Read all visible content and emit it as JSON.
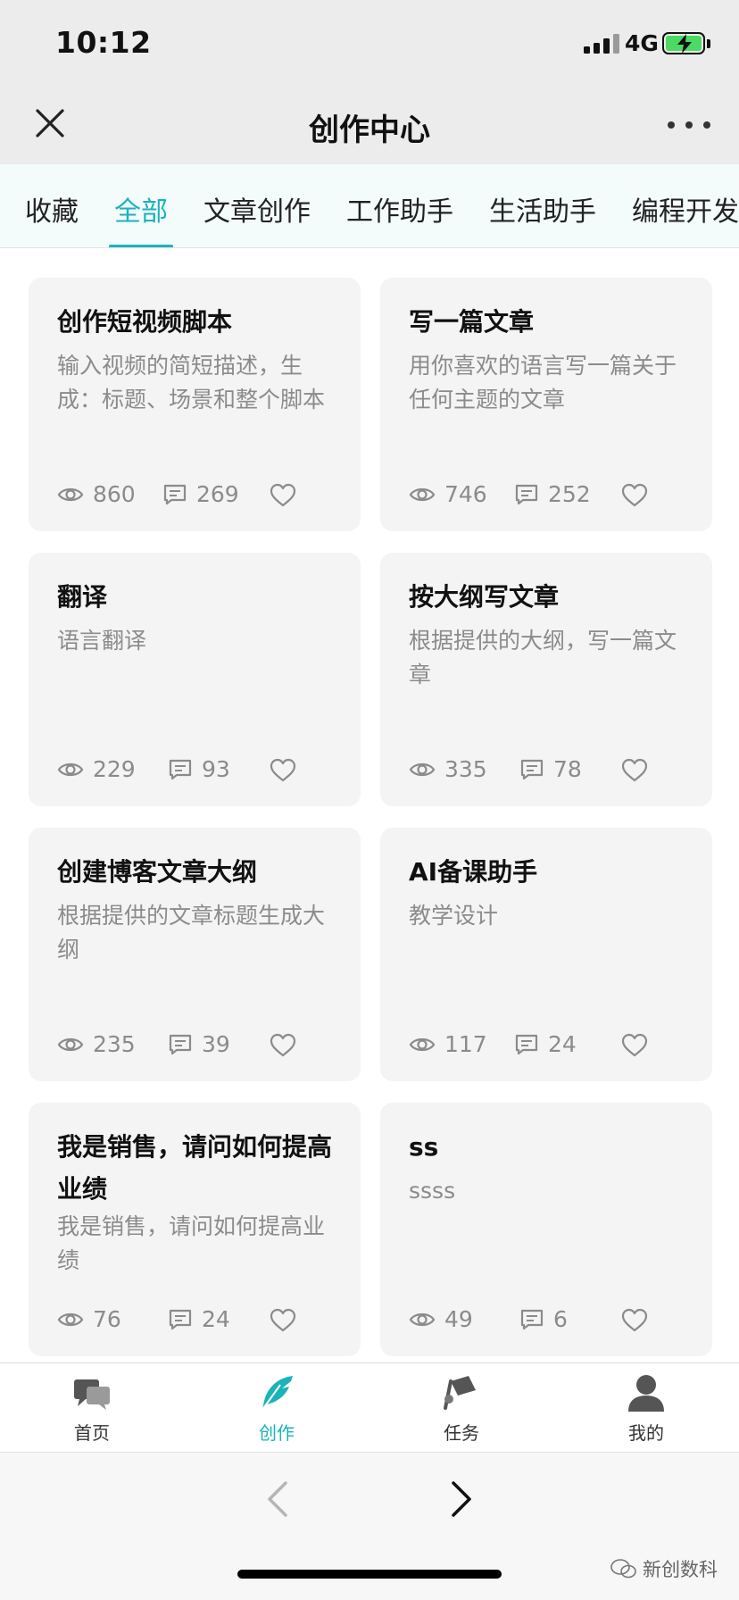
{
  "status_bar": {
    "time": "10:12",
    "network": "4G"
  },
  "header": {
    "title": "创作中心"
  },
  "tabs": [
    {
      "label": "收藏"
    },
    {
      "label": "全部"
    },
    {
      "label": "文章创作"
    },
    {
      "label": "工作助手"
    },
    {
      "label": "生活助手"
    },
    {
      "label": "编程开发"
    }
  ],
  "active_tab": "全部",
  "cards": [
    {
      "title": "创作短视频脚本",
      "desc": "输入视频的简短描述，生成：标题、场景和整个脚本",
      "views": "860",
      "comments": "269"
    },
    {
      "title": "写一篇文章",
      "desc": "用你喜欢的语言写一篇关于任何主题的文章",
      "views": "746",
      "comments": "252"
    },
    {
      "title": "翻译",
      "desc": "语言翻译",
      "views": "229",
      "comments": "93"
    },
    {
      "title": "按大纲写文章",
      "desc": "根据提供的大纲，写一篇文章",
      "views": "335",
      "comments": "78"
    },
    {
      "title": "创建博客文章大纲",
      "desc": "根据提供的文章标题生成大纲",
      "views": "235",
      "comments": "39"
    },
    {
      "title": "AI备课助手",
      "desc": "教学设计",
      "views": "117",
      "comments": "24"
    },
    {
      "title": "我是销售，请问如何提高业绩",
      "desc": "我是销售，请问如何提高业绩",
      "views": "76",
      "comments": "24"
    },
    {
      "title": "ss",
      "desc": "ssss",
      "views": "49",
      "comments": "6"
    }
  ],
  "bottom_nav": [
    {
      "label": "首页",
      "icon": "chat-bubbles-icon"
    },
    {
      "label": "创作",
      "icon": "feather-icon"
    },
    {
      "label": "任务",
      "icon": "flag-hand-icon"
    },
    {
      "label": "我的",
      "icon": "user-icon"
    }
  ],
  "active_nav": "创作",
  "watermark": "新创数科",
  "colors": {
    "accent": "#1ab3b8",
    "card_bg": "#f4f4f5",
    "header_bg": "#ececec",
    "tab_bg": "#f4fbfb",
    "muted_text": "#8b8b8b"
  }
}
